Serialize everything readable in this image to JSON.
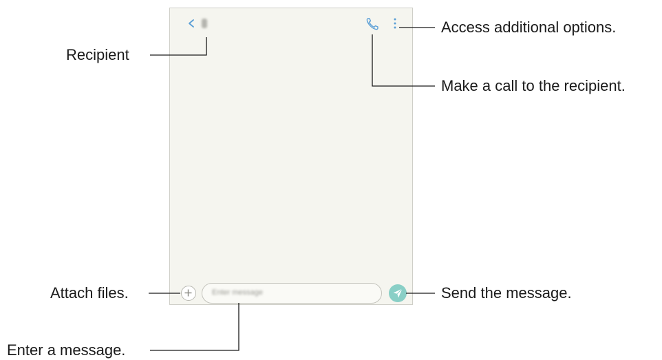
{
  "screen": {
    "placeholder": "Enter message",
    "colors": {
      "background": "#f5f5ef",
      "accent": "#5b9fd6",
      "send_button": "#89cfc6"
    },
    "icons": [
      "back-icon",
      "call-icon",
      "more-options-icon",
      "attach-icon",
      "send-icon"
    ]
  },
  "callouts": {
    "recipient": "Recipient",
    "more_options": "Access additional options.",
    "call": "Make a call to the recipient.",
    "attach": "Attach files.",
    "send": "Send the message.",
    "enter_message": "Enter a message."
  }
}
